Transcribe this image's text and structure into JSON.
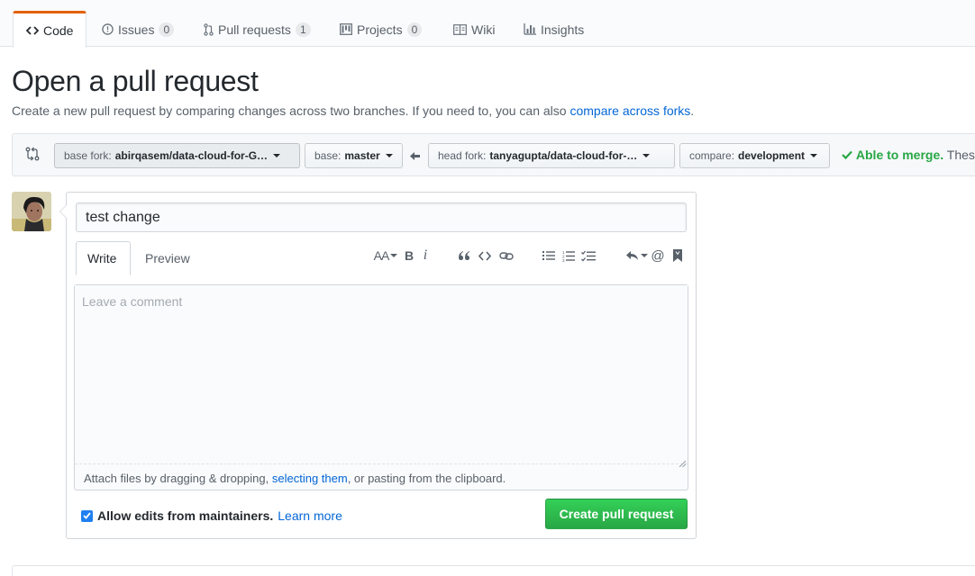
{
  "nav": {
    "tabs": [
      {
        "label": "Code",
        "icon": "code-icon",
        "selected": true
      },
      {
        "label": "Issues",
        "icon": "issue-opened-icon",
        "count": "0"
      },
      {
        "label": "Pull requests",
        "icon": "git-pull-request-icon",
        "count": "1"
      },
      {
        "label": "Projects",
        "icon": "project-icon",
        "count": "0"
      },
      {
        "label": "Wiki",
        "icon": "book-icon"
      },
      {
        "label": "Insights",
        "icon": "graph-icon"
      }
    ]
  },
  "page": {
    "title": "Open a pull request",
    "subtitle": "Create a new pull request by comparing changes across two branches. If you need to, you can also ",
    "subtitle_link": "compare across forks",
    "subtitle_end": "."
  },
  "range": {
    "base_fork_label": "base fork:",
    "base_fork_value": "abirqasem/data-cloud-for-G…",
    "base_label": "base:",
    "base_value": "master",
    "head_fork_label": "head fork:",
    "head_fork_value": "tanyagupta/data-cloud-for-…",
    "compare_label": "compare:",
    "compare_value": "development",
    "merge_status": "Able to merge.",
    "merge_rest": "These branches can be automatically merged."
  },
  "form": {
    "title_value": "test change",
    "tab_write": "Write",
    "tab_preview": "Preview",
    "comment_placeholder": "Leave a comment",
    "attach_text_1": "Attach files by dragging & dropping, ",
    "attach_link": "selecting them",
    "attach_text_2": ", or pasting from the clipboard.",
    "allow_edits_label": "Allow edits from maintainers.",
    "allow_edits_checked": true,
    "learn_more": "Learn more",
    "submit_label": "Create pull request"
  },
  "toolbar": {
    "header_label": "AA",
    "bold_label": "B",
    "italic_label": "i",
    "icons": [
      "text-size-icon",
      "bold-icon",
      "italic-icon",
      "quote-icon",
      "code-icon",
      "link-icon",
      "unordered-list-icon",
      "ordered-list-icon",
      "task-list-icon",
      "reply-icon",
      "mention-icon",
      "bookmark-icon"
    ]
  },
  "colors": {
    "accent_orange": "#e36209",
    "link_blue": "#0366d6",
    "success_green": "#28a745"
  }
}
